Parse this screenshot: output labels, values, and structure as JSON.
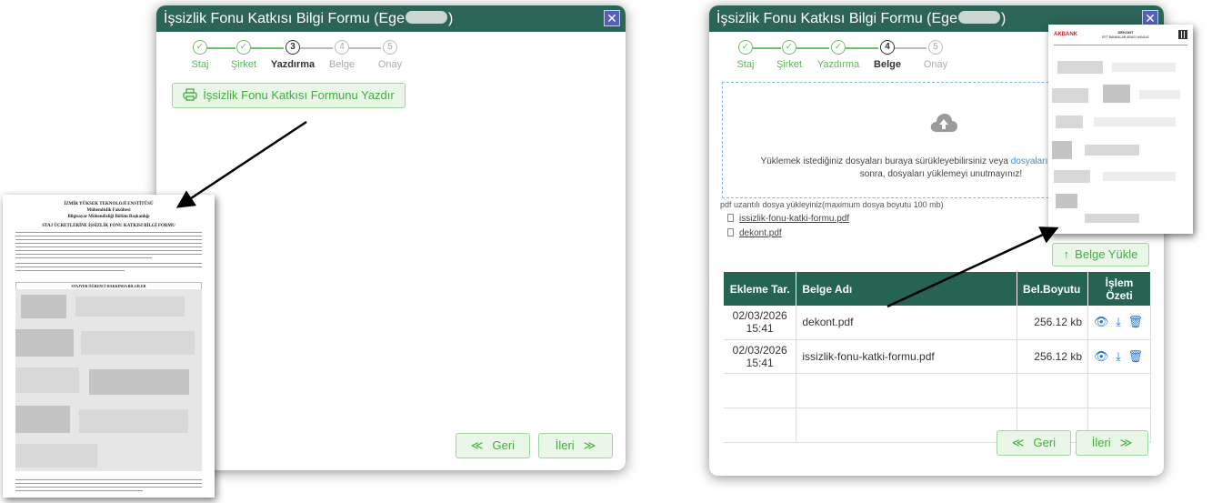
{
  "modal_a": {
    "title_prefix": "İşsizlik Fonu Katkısı Bilgi Formu (Ege",
    "title_suffix": ")",
    "close_glyph": "✕",
    "steps": [
      {
        "num": "✓",
        "label": "Staj",
        "state": "done"
      },
      {
        "num": "✓",
        "label": "Şirket",
        "state": "done"
      },
      {
        "num": "3",
        "label": "Yazdırma",
        "state": "active"
      },
      {
        "num": "4",
        "label": "Belge",
        "state": "todo"
      },
      {
        "num": "5",
        "label": "Onay",
        "state": "todo"
      }
    ],
    "print_button": "İşsizlik Fonu Katkısı Formunu Yazdır",
    "back_button": "Geri",
    "next_button": "İleri"
  },
  "modal_b": {
    "title_prefix": "İşsizlik Fonu Katkısı Bilgi Formu (Ege",
    "title_suffix": ")",
    "close_glyph": "✕",
    "steps": [
      {
        "num": "✓",
        "label": "Staj",
        "state": "done"
      },
      {
        "num": "✓",
        "label": "Şirket",
        "state": "done"
      },
      {
        "num": "✓",
        "label": "Yazdırma",
        "state": "done"
      },
      {
        "num": "4",
        "label": "Belge",
        "state": "active"
      },
      {
        "num": "5",
        "label": "Onay",
        "state": "todo"
      }
    ],
    "dropzone": {
      "text_before": "Yüklemek istediğiniz dosyaları buraya sürükleyebilirsiniz veya ",
      "link": "dosyaları seçmek için tıklay",
      "text_line2": "sonra, dosyaları yüklemeyi unutmayınız!"
    },
    "hint": "pdf uzantılı dosya yükleyiniz(maximum dosya boyutu 100 mb)",
    "files": [
      "issizlik-fonu-katki-formu.pdf",
      "dekont.pdf"
    ],
    "upload_button": "Belge Yükle",
    "table": {
      "headers": [
        "Ekleme Tar.",
        "Belge Adı",
        "Bel.Boyutu",
        "İşlem Özeti"
      ],
      "rows": [
        {
          "date": "02/03/2026",
          "time": "15:41",
          "name": "dekont.pdf",
          "size": "256.12 kb"
        },
        {
          "date": "02/03/2026",
          "time": "15:41",
          "name": "issizlik-fonu-katki-formu.pdf",
          "size": "256.12 kb"
        }
      ],
      "actions": "👁 ⤓ 🗑"
    },
    "back_button": "Geri",
    "next_button": "İleri"
  },
  "document_form": {
    "line1": "İZMİR YÜKSEK TEKNOLOJİ ENSTİTÜSÜ",
    "line2": "Mühendislik Fakültesi",
    "line3": "Bilgisayar Mühendisliği Bölüm Başkanlığı",
    "heading": "STAJ ÜCRETLERİNE İŞSİZLİK FONU KATKISI BİLGİ FORMU",
    "section": "STAJYER ÖĞRENCİ HAKKINDA BİLGİLER"
  },
  "document_receipt": {
    "bank": "AKBANK",
    "heading": "DEKONT",
    "subheading": "EFT BANKALAR ARASI HAVALE"
  },
  "colors": {
    "titlebar": "#2c6457",
    "table_header": "#256451",
    "accent_green": "#5cb85c",
    "link_blue": "#3a8fd6",
    "close_blue": "#5561b8"
  }
}
